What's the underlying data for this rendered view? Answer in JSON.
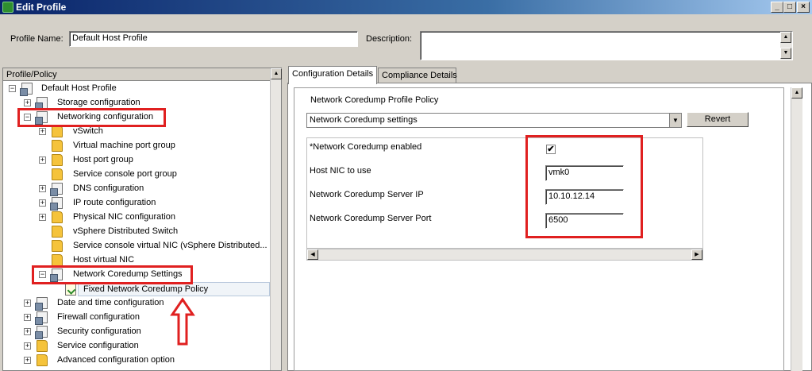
{
  "window": {
    "title": "Edit Profile",
    "controls": {
      "minimize": "_",
      "restore": "□",
      "close": "×"
    }
  },
  "form": {
    "profile_name_label": "Profile Name:",
    "profile_name_value": "Default Host Profile",
    "description_label": "Description:",
    "description_value": ""
  },
  "tree": {
    "header": "Profile/Policy",
    "items": [
      {
        "label": "Default Host Profile",
        "expander": "−",
        "icon": "profile-icon"
      },
      {
        "label": "Storage configuration",
        "expander": "+",
        "icon": "profile-icon"
      },
      {
        "label": "Networking configuration",
        "expander": "−",
        "icon": "profile-icon"
      },
      {
        "label": "vSwitch",
        "expander": "+",
        "icon": "folder-icon"
      },
      {
        "label": "Virtual machine port group",
        "expander": "",
        "icon": "folder-icon"
      },
      {
        "label": "Host port group",
        "expander": "+",
        "icon": "folder-icon"
      },
      {
        "label": "Service console port group",
        "expander": "",
        "icon": "folder-icon"
      },
      {
        "label": "DNS configuration",
        "expander": "+",
        "icon": "profile-icon"
      },
      {
        "label": "IP route configuration",
        "expander": "+",
        "icon": "profile-icon"
      },
      {
        "label": "Physical NIC configuration",
        "expander": "+",
        "icon": "folder-icon"
      },
      {
        "label": "vSphere Distributed Switch",
        "expander": "",
        "icon": "folder-icon"
      },
      {
        "label": "Service console virtual NIC (vSphere Distributed...",
        "expander": "",
        "icon": "folder-icon"
      },
      {
        "label": "Host virtual NIC",
        "expander": "",
        "icon": "folder-icon"
      },
      {
        "label": "Network Coredump Settings",
        "expander": "−",
        "icon": "profile-icon"
      },
      {
        "label": "Fixed Network Coredump Policy",
        "expander": "",
        "icon": "policy-icon"
      },
      {
        "label": "Date and time configuration",
        "expander": "+",
        "icon": "profile-icon"
      },
      {
        "label": "Firewall configuration",
        "expander": "+",
        "icon": "profile-icon"
      },
      {
        "label": "Security configuration",
        "expander": "+",
        "icon": "profile-icon"
      },
      {
        "label": "Service configuration",
        "expander": "+",
        "icon": "folder-icon"
      },
      {
        "label": "Advanced configuration option",
        "expander": "+",
        "icon": "folder-icon"
      }
    ]
  },
  "tabs": [
    {
      "label": "Configuration Details",
      "active": true
    },
    {
      "label": "Compliance Details",
      "active": false
    }
  ],
  "details": {
    "policy_title": "Network Coredump Profile Policy",
    "dropdown_value": "Network Coredump settings",
    "revert_label": "Revert",
    "fields": [
      {
        "label": "*Network Coredump enabled",
        "type": "checkbox",
        "value": "✔"
      },
      {
        "label": "Host NIC to use",
        "type": "text",
        "value": "vmk0"
      },
      {
        "label": "Network Coredump Server IP",
        "type": "text",
        "value": "10.10.12.14"
      },
      {
        "label": "Network Coredump Server Port",
        "type": "text",
        "value": "6500"
      }
    ]
  },
  "colors": {
    "highlight_red": "#e02020",
    "titlebar_start": "#0a246a",
    "titlebar_end": "#a6caf0"
  }
}
